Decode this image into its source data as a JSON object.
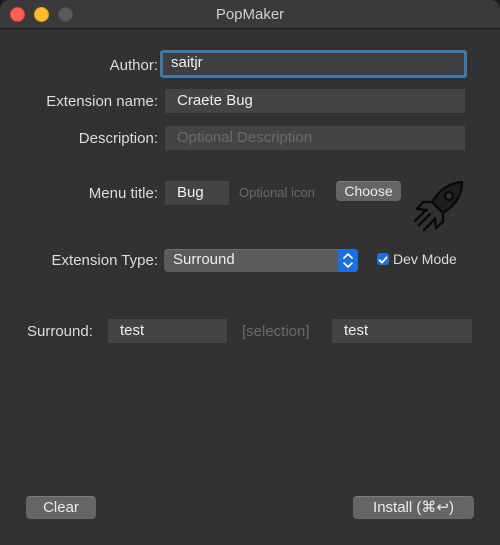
{
  "window": {
    "title": "PopMaker"
  },
  "form": {
    "author_label": "Author:",
    "author_value": "saitjr",
    "extension_name_label": "Extension name:",
    "extension_name_value": "Craete Bug",
    "description_label": "Description:",
    "description_placeholder": "Optional Description",
    "menu_title_label": "Menu title:",
    "menu_title_value": "Bug",
    "optional_icon_text": "Optional icon",
    "choose_button": "Choose",
    "extension_type_label": "Extension Type:",
    "extension_type_value": "Surround",
    "dev_mode_label": "Dev Mode",
    "dev_mode_checked": true,
    "surround_label": "Surround:",
    "surround_prefix": "test",
    "selection_text": "[selection]",
    "surround_suffix": "test"
  },
  "buttons": {
    "clear": "Clear",
    "install": "Install (⌘↩)"
  },
  "icons": {
    "menu_icon": "rocket-icon",
    "accent": "#1b6fe0",
    "focus_ring": "#3d7aab"
  }
}
